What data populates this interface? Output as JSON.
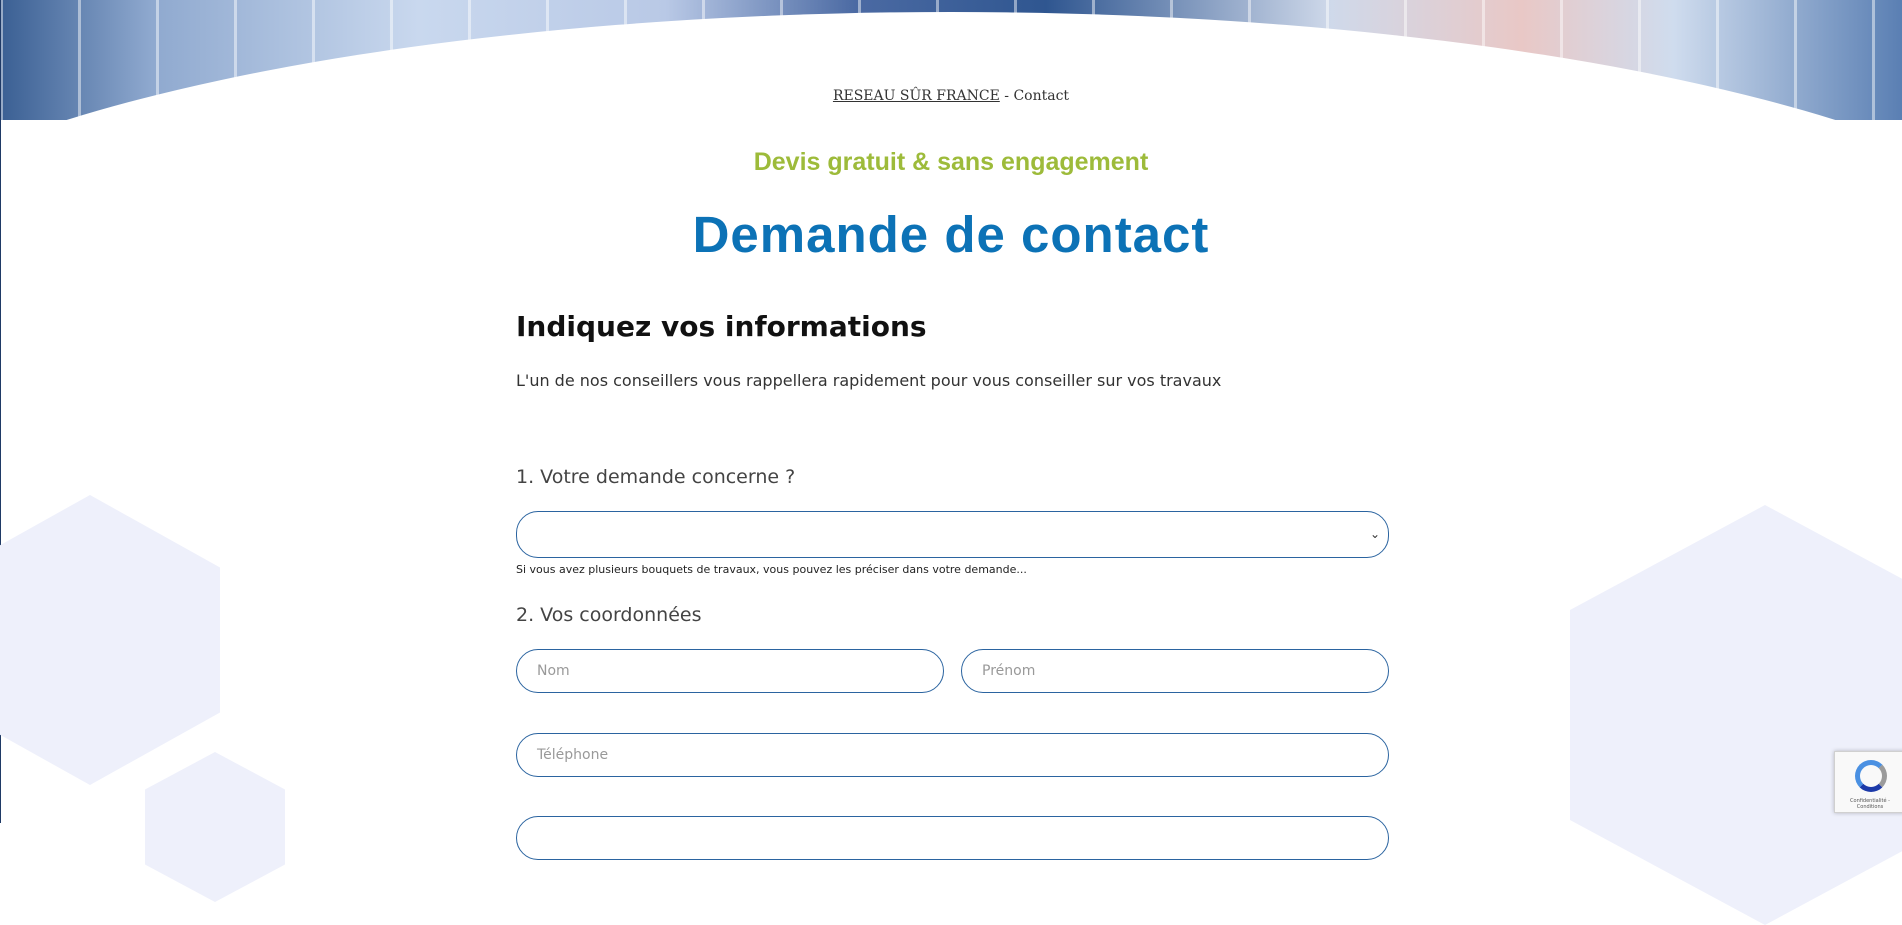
{
  "breadcrumb": {
    "home": "RESEAU SÛR FRANCE",
    "separator": " - ",
    "current": "Contact"
  },
  "hero": {
    "subtitle": "Devis gratuit & sans engagement",
    "title": "Demande de contact"
  },
  "form": {
    "heading": "Indiquez vos informations",
    "intro": "L'un de nos conseillers vous rappellera rapidement pour vous conseiller sur vos travaux",
    "question1": "1. Votre demande concerne ?",
    "select_value": "",
    "helper": "Si vous avez plusieurs bouquets de travaux, vous pouvez les préciser dans votre demande...",
    "question2": "2. Vos coordonnées",
    "nom_placeholder": "Nom",
    "prenom_placeholder": "Prénom",
    "telephone_placeholder": "Téléphone"
  },
  "recaptcha": {
    "label": "Confidentialité - Conditions"
  },
  "colors": {
    "accent_green": "#9dbb3a",
    "title_blue": "#0c72b6",
    "field_border": "#2b64a0"
  }
}
